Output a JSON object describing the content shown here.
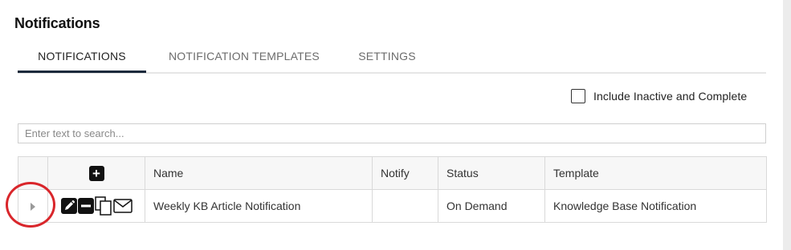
{
  "page": {
    "title": "Notifications"
  },
  "tabs": [
    {
      "label": "NOTIFICATIONS",
      "active": true
    },
    {
      "label": "NOTIFICATION TEMPLATES",
      "active": false
    },
    {
      "label": "SETTINGS",
      "active": false
    }
  ],
  "filters": {
    "include_inactive_label": "Include Inactive and Complete",
    "include_inactive_checked": false
  },
  "search": {
    "placeholder": "Enter text to search...",
    "value": ""
  },
  "grid": {
    "headers": {
      "name": "Name",
      "notify": "Notify",
      "status": "Status",
      "template": "Template"
    },
    "add_icon": "plus-square-icon",
    "rows": [
      {
        "name": "Weekly KB Article Notification",
        "notify": "",
        "status": "On Demand",
        "template": "Knowledge Base Notification",
        "actions": [
          "pencil-icon",
          "minus-square-icon",
          "copy-icon",
          "envelope-icon"
        ]
      }
    ]
  },
  "colors": {
    "active_tab_underline": "#1c2a3c",
    "annotation_circle": "#d9262b"
  }
}
